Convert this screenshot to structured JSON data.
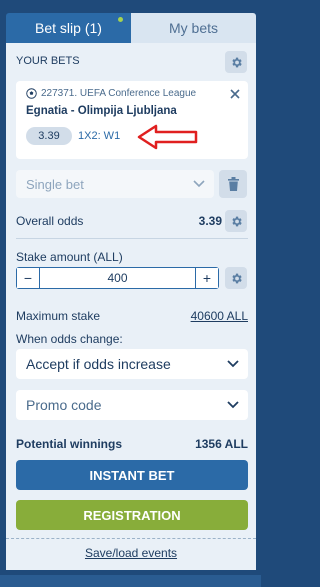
{
  "tabs": {
    "bet_slip": "Bet slip (1)",
    "my_bets": "My bets"
  },
  "your_bets": {
    "header": "YOUR BETS",
    "bet": {
      "event": "227371. UEFA Conference League",
      "match": "Egnatia - Olimpija Ljubljana",
      "odds": "3.39",
      "outcome": "1X2: W1"
    }
  },
  "bet_type": {
    "selected": "Single bet"
  },
  "overall_odds": {
    "label": "Overall odds",
    "value": "3.39"
  },
  "stake": {
    "label": "Stake amount (ALL)",
    "value": "400",
    "minus": "−",
    "plus": "+"
  },
  "maximum_stake": {
    "label": "Maximum stake",
    "value": "40600 ALL"
  },
  "odds_change": {
    "label": "When odds change:",
    "selected": "Accept if odds increase"
  },
  "promo": {
    "placeholder": "Promo code"
  },
  "potential_winnings": {
    "label": "Potential winnings",
    "value": "1356 ALL"
  },
  "actions": {
    "instant_bet": "INSTANT BET",
    "registration": "REGISTRATION",
    "save_load": "Save/load events"
  },
  "icons": {
    "gear": "gear-icon",
    "close": "close-icon",
    "trash": "trash-icon",
    "chevron": "chevron-down-icon",
    "ball": "soccer-ball-icon"
  },
  "colors": {
    "primary": "#2b6aa7",
    "green": "#88ad3a",
    "annotation_red": "#e02020",
    "tab_dot": "#a6d34f"
  }
}
